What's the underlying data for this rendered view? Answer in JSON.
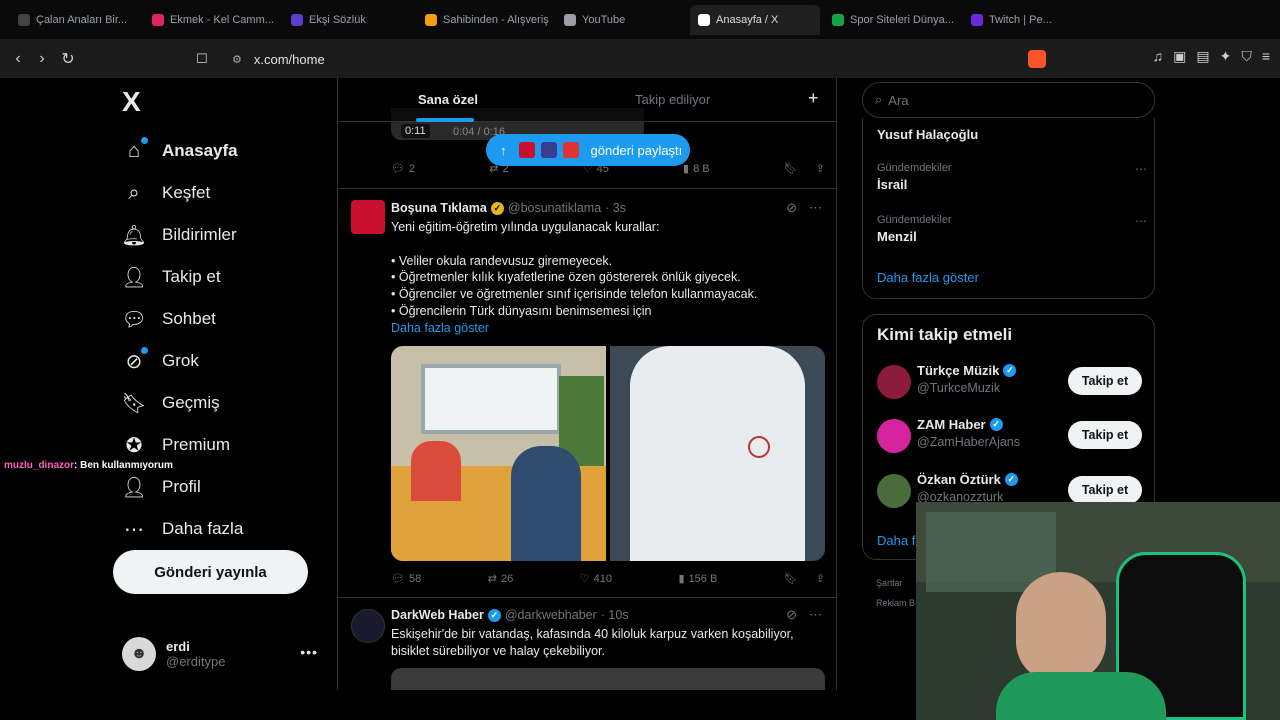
{
  "browser": {
    "tabs": [
      {
        "label": "Çalan Anaları Bir...",
        "color": "#444"
      },
      {
        "label": "Ekmek - Kel Camm...",
        "color": "#e0245e"
      },
      {
        "label": "Ekşi Sözlük",
        "color": "#5b3fd1"
      },
      {
        "label": "Sahibinden - Alışveriş",
        "color": "#f59e0b"
      },
      {
        "label": "YouTube",
        "color": "#9aa0a6"
      },
      {
        "label": "Anasayfa / X",
        "color": "#ffffff"
      },
      {
        "label": "Spor Siteleri Dünya...",
        "color": "#16a34a"
      },
      {
        "label": "Twitch | Pe...",
        "color": "#6d28d9"
      }
    ],
    "url": "x.com/home"
  },
  "sidebar": {
    "logo": "X",
    "items": [
      {
        "label": "Anasayfa",
        "icon": "home-icon",
        "glyph": "⌂"
      },
      {
        "label": "Keşfet",
        "icon": "search-icon",
        "glyph": "⌕"
      },
      {
        "label": "Bildirimler",
        "icon": "bell-icon",
        "glyph": "🔔︎"
      },
      {
        "label": "Takip et",
        "icon": "person-add-icon",
        "glyph": "👤︎"
      },
      {
        "label": "Sohbet",
        "icon": "chat-icon",
        "glyph": "💬︎"
      },
      {
        "label": "Grok",
        "icon": "grok-icon",
        "glyph": "⊘"
      },
      {
        "label": "Geçmiş",
        "icon": "bookmark-icon",
        "glyph": "🔖︎"
      },
      {
        "label": "Premium",
        "icon": "verified-icon",
        "glyph": "✪"
      },
      {
        "label": "Profil",
        "icon": "person-icon",
        "glyph": "👤︎"
      },
      {
        "label": "Daha fazla",
        "icon": "more-circle-icon",
        "glyph": "⋯"
      }
    ],
    "post_button": "Gönderi yayınla",
    "user": {
      "name": "erdi",
      "handle": "@erditype"
    },
    "chat_overlay": {
      "user": "muzlu_dinazor",
      "message": ": Ben kullanmıyorum"
    }
  },
  "feed": {
    "tabs": [
      "Sana özel",
      "Takip ediliyor"
    ],
    "previous_tweet": {
      "video_time": "0:11",
      "video_progress": "0:04 / 0:16",
      "replies": "2",
      "reposts": "2",
      "likes": "45",
      "views": "8 B"
    },
    "new_posts_pill": "gönderi paylaştı",
    "tweet1": {
      "name": "Boşuna Tıklama",
      "handle": "@bosunatiklama",
      "time": "· 3s",
      "lines": [
        "Yeni eğitim-öğretim yılında uygulanacak kurallar:",
        "",
        "• Veliler okula randevusuz giremeyecek.",
        "• Öğretmenler kılık kıyafetlerine özen göstererek önlük giyecek.",
        "• Öğrenciler ve öğretmenler sınıf içerisinde telefon kullanmayacak.",
        "• Öğrencilerin Türk dünyasını benimsemesi için"
      ],
      "show_more": "Daha fazla göster",
      "replies": "58",
      "reposts": "26",
      "likes": "410",
      "views": "156 B"
    },
    "tweet2": {
      "name": "DarkWeb Haber",
      "handle": "@darkwebhaber",
      "time": "· 10s",
      "lines": [
        "Eskişehir'de bir vatandaş, kafasında 40 kiloluk karpuz varken koşabiliyor,",
        "bisiklet sürebiliyor ve halay çekebiliyor."
      ]
    }
  },
  "right": {
    "search_placeholder": "Ara",
    "trends": [
      {
        "category": "",
        "title": "Yusuf Halaçoğlu"
      },
      {
        "category": "Gündemdekiler",
        "title": "İsrail"
      },
      {
        "category": "Gündemdekiler",
        "title": "Menzil"
      }
    ],
    "trends_more": "Daha fazla göster",
    "who_title": "Kimi takip etmeli",
    "who": [
      {
        "name": "Türkçe Müzik",
        "handle": "@TurkceMuzik",
        "color": "#8b1c3a"
      },
      {
        "name": "ZAM Haber",
        "handle": "@ZamHaberAjans",
        "color": "#d6249f"
      },
      {
        "name": "Özkan Öztürk",
        "handle": "@ozkanozzturk",
        "color": "#4a6b3a"
      }
    ],
    "follow_label": "Takip et",
    "who_more": "Daha fa",
    "footer1": "Şartlar",
    "footer2": "Reklam B"
  },
  "colors": {
    "accent": "#1d9bf0",
    "verified_gold": "#e2b719",
    "verified_blue": "#1d9bf0"
  }
}
